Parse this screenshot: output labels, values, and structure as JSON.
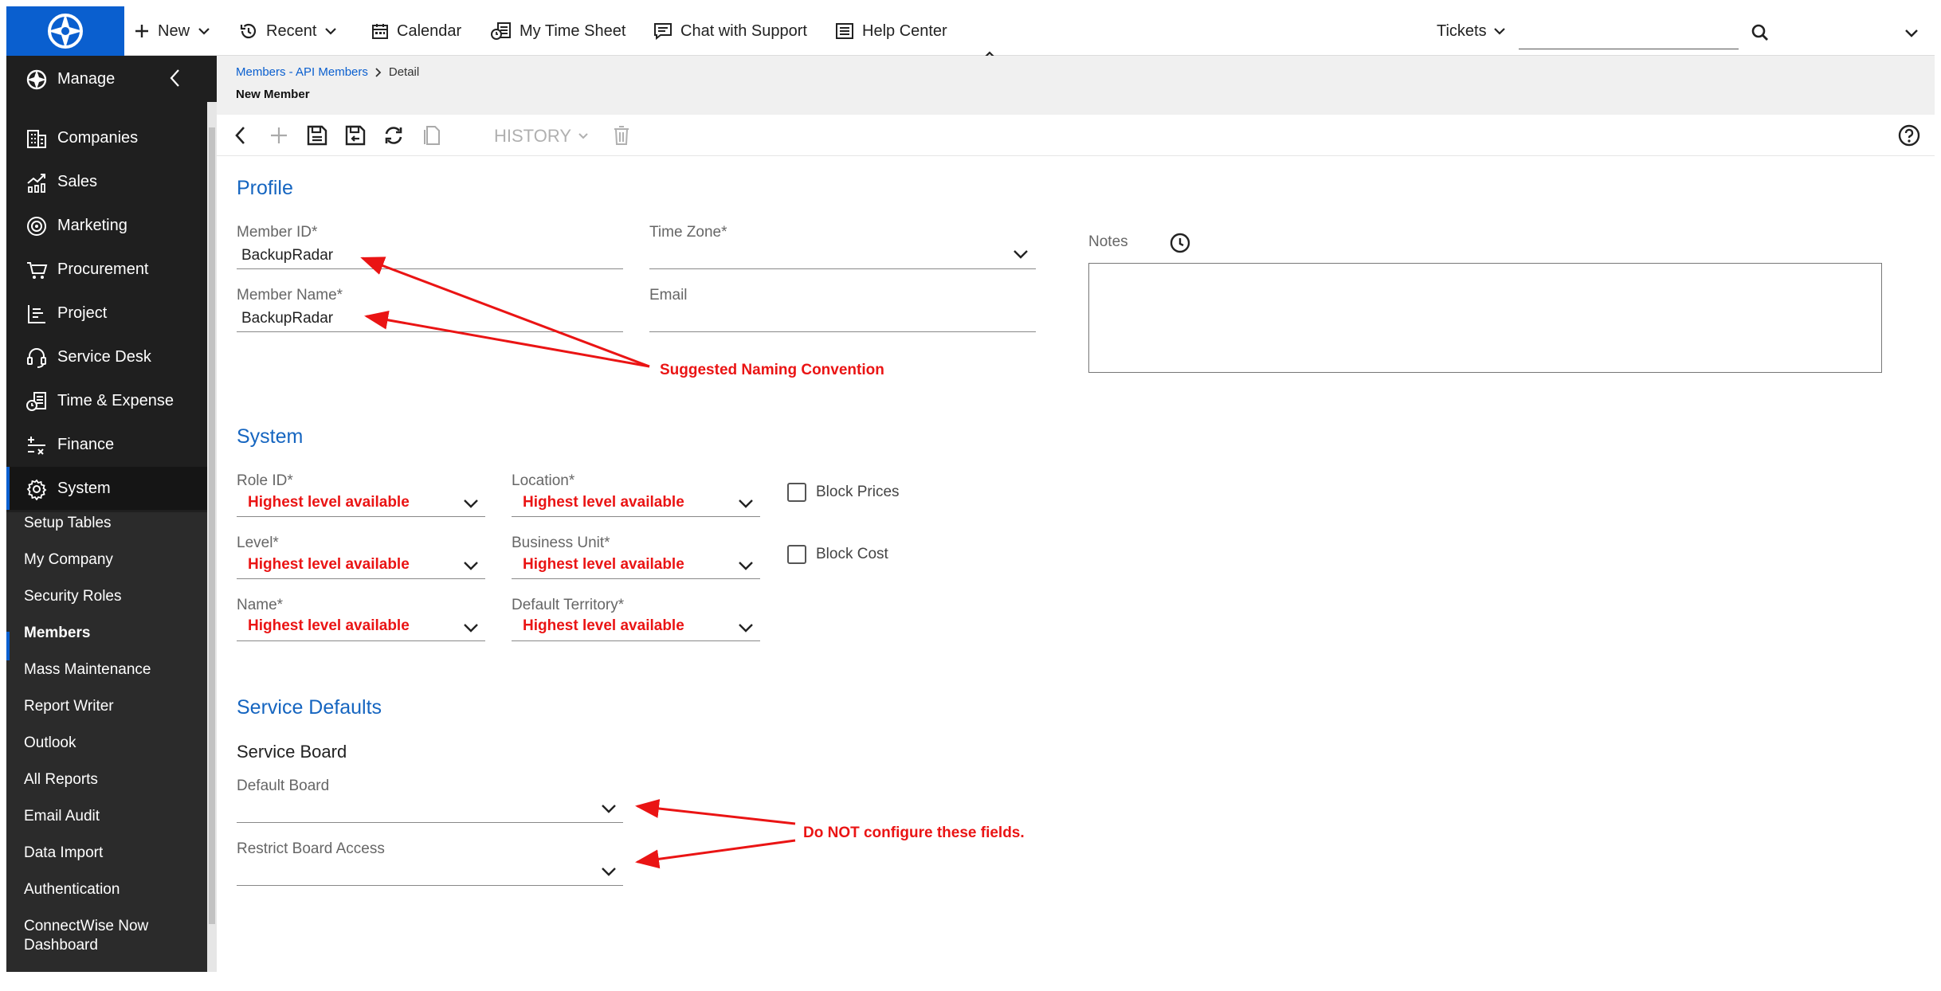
{
  "topbar": {
    "new_label": "New",
    "recent_label": "Recent",
    "calendar_label": "Calendar",
    "timesheet_label": "My Time Sheet",
    "chat_label": "Chat with Support",
    "help_label": "Help Center",
    "tickets_label": "Tickets",
    "search_placeholder": "",
    "brand_color": "#0a5fcf"
  },
  "sidebar": {
    "manage_label": "Manage",
    "items": [
      {
        "label": "Companies",
        "icon": "companies-icon"
      },
      {
        "label": "Sales",
        "icon": "sales-icon"
      },
      {
        "label": "Marketing",
        "icon": "marketing-icon"
      },
      {
        "label": "Procurement",
        "icon": "procurement-icon"
      },
      {
        "label": "Project",
        "icon": "project-icon"
      },
      {
        "label": "Service Desk",
        "icon": "service-desk-icon"
      },
      {
        "label": "Time & Expense",
        "icon": "time-expense-icon"
      },
      {
        "label": "Finance",
        "icon": "finance-icon"
      },
      {
        "label": "System",
        "icon": "system-gear-icon"
      }
    ],
    "subitems": [
      "Setup Tables",
      "My Company",
      "Security Roles",
      "Members",
      "Mass Maintenance",
      "Report Writer",
      "Outlook",
      "All Reports",
      "Email Audit",
      "Data Import",
      "Authentication",
      "ConnectWise Now",
      "Dashboard"
    ]
  },
  "breadcrumb": {
    "link": "Members - API Members",
    "current": "Detail",
    "page_title": "New Member"
  },
  "toolbar": {
    "history_label": "HISTORY"
  },
  "profile": {
    "title": "Profile",
    "member_id_label": "Member ID*",
    "member_id_value": "BackupRadar",
    "member_name_label": "Member Name*",
    "member_name_value": "BackupRadar",
    "time_zone_label": "Time Zone*",
    "email_label": "Email",
    "notes_label": "Notes"
  },
  "system": {
    "title": "System",
    "role_id_label": "Role ID*",
    "role_id_value": "Highest level available",
    "location_label": "Location*",
    "location_value": "Highest level available",
    "level_label": "Level*",
    "level_value": "Highest level available",
    "business_unit_label": "Business Unit*",
    "business_unit_value": "Highest level available",
    "name_label": "Name*",
    "name_value": "Highest level available",
    "default_territory_label": "Default Territory*",
    "default_territory_value": "Highest level available",
    "block_prices_label": "Block Prices",
    "block_cost_label": "Block Cost"
  },
  "service_defaults": {
    "title": "Service Defaults",
    "subtitle": "Service Board",
    "default_board_label": "Default Board",
    "restrict_board_label": "Restrict Board Access"
  },
  "annotations": {
    "naming": "Suggested Naming Convention",
    "do_not": "Do NOT configure these fields.",
    "color": "#ea1414"
  }
}
